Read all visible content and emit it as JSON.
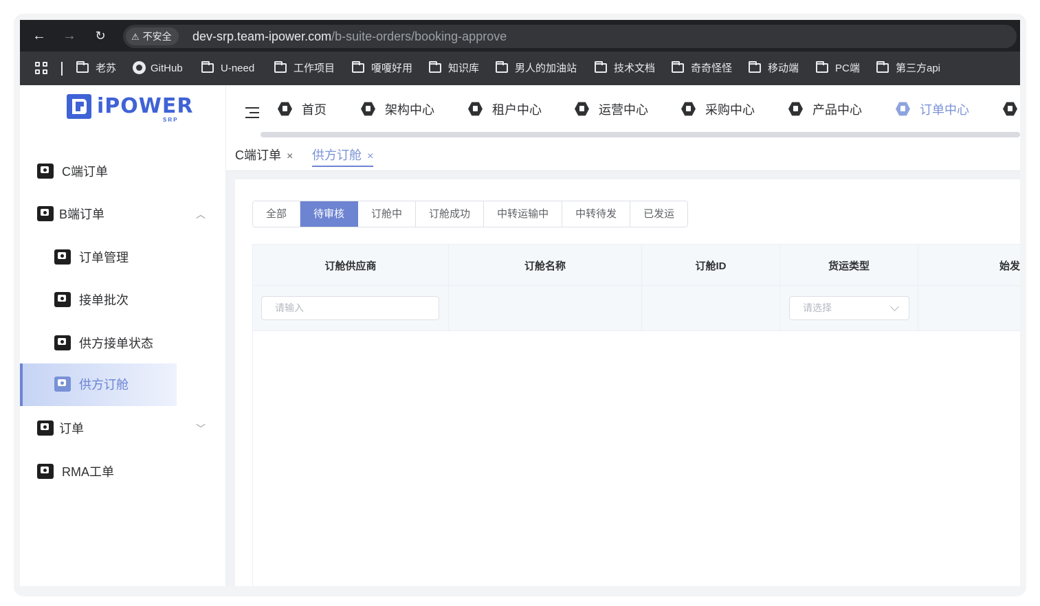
{
  "browser": {
    "security_label": "不安全",
    "url_host": "dev-srp.team-ipower.com",
    "url_path": "/b-suite-orders/booking-approve",
    "bookmarks": [
      "老苏",
      "GitHub",
      "U-need",
      "工作项目",
      "嗄嗄好用",
      "知识库",
      "男人的加油站",
      "技术文档",
      "奇奇怪怪",
      "移动端",
      "PC端",
      "第三方api"
    ]
  },
  "logo": {
    "text": "iPOWER",
    "sub": "SRP"
  },
  "sidebar": {
    "items": [
      {
        "label": "C端订单"
      },
      {
        "label": "B端订单",
        "expanded": true
      },
      {
        "label": "订单管理"
      },
      {
        "label": "接单批次"
      },
      {
        "label": "供方接单状态"
      },
      {
        "label": "供方订舱",
        "active": true
      },
      {
        "label": "订单",
        "expanded": false
      },
      {
        "label": "RMA工单"
      }
    ]
  },
  "topnav": {
    "items": [
      "首页",
      "架构中心",
      "租户中心",
      "运营中心",
      "采购中心",
      "产品中心",
      "订单中心"
    ],
    "active": "订单中心"
  },
  "tags": [
    {
      "label": "C端订单",
      "close": "×"
    },
    {
      "label": "供方订舱",
      "close": "×",
      "active": true
    }
  ],
  "status_tabs": {
    "items": [
      "全部",
      "待审核",
      "订舱中",
      "订舱成功",
      "中转运输中",
      "中转待发",
      "已发运"
    ],
    "active": "待审核"
  },
  "table": {
    "columns": [
      "订舱供应商",
      "订舱名称",
      "订舱ID",
      "货运类型",
      "始发"
    ],
    "filters": {
      "supplier_placeholder": "请输入",
      "freight_placeholder": "请选择"
    }
  },
  "colors": {
    "accent": "#6d84d2",
    "brand": "#3f63d6"
  }
}
